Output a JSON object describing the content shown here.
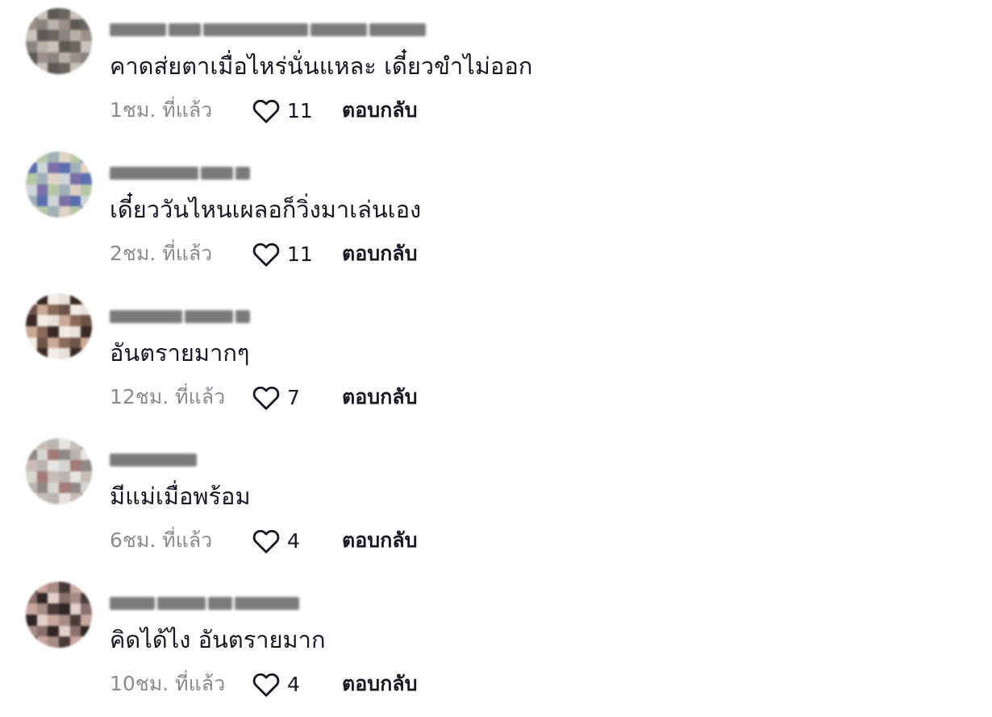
{
  "comments": [
    {
      "username": "Cal ulaen_Diamond_Gem",
      "text": "คาดส่ยตาเมื่อไหร่นั่นแหละ เดี๋ยวขำไม่ออก",
      "time": "1ชม. ที่แล้ว",
      "likes": "11",
      "reply_label": "ตอบกลับ",
      "avatar_colors": [
        "#6b6560",
        "#9a8f88",
        "#c9c2bb",
        "#8a8480",
        "#5d5a55",
        "#b8b1a9"
      ]
    },
    {
      "username": "Bonanza!!",
      "text": "เดี๋ยววันไหนเผลอก็วิ่งมาเล่นเอง",
      "time": "2ชม. ที่แล้ว",
      "likes": "11",
      "reply_label": "ตอบกลับ",
      "avatar_colors": [
        "#cfd6d9",
        "#9fb0b8",
        "#7c6fa8",
        "#e0d2c4",
        "#5a6fb0",
        "#b7c7a6"
      ]
    },
    {
      "username": "Mantaka31",
      "text": "อันตรายมากๆ",
      "time": "12ชม. ที่แล้ว",
      "likes": "7",
      "reply_label": "ตอบกลับ",
      "avatar_colors": [
        "#e8e1da",
        "#6d5448",
        "#3a2a25",
        "#c9a896",
        "#f2ece6",
        "#8c6a5a"
      ]
    },
    {
      "username": "Sniggle",
      "text": "มีแม่เมื่อพร้อม",
      "time": "6ชม. ที่แล้ว",
      "likes": "4",
      "reply_label": "ตอบกลับ",
      "avatar_colors": [
        "#d8d6d3",
        "#b9b4b0",
        "#a37a78",
        "#e6e4e1",
        "#8f8a86",
        "#c7bdb6"
      ]
    },
    {
      "username": "ฟ้าใส ฟ้าใส",
      "text": "คิดได้ไง อันตรายมาก",
      "time": "10ชม. ที่แล้ว",
      "likes": "4",
      "reply_label": "ตอบกลับ",
      "avatar_colors": [
        "#4a3b3a",
        "#8a6f6c",
        "#c9a6a0",
        "#2f2727",
        "#a78b86",
        "#e2cfca"
      ]
    }
  ]
}
